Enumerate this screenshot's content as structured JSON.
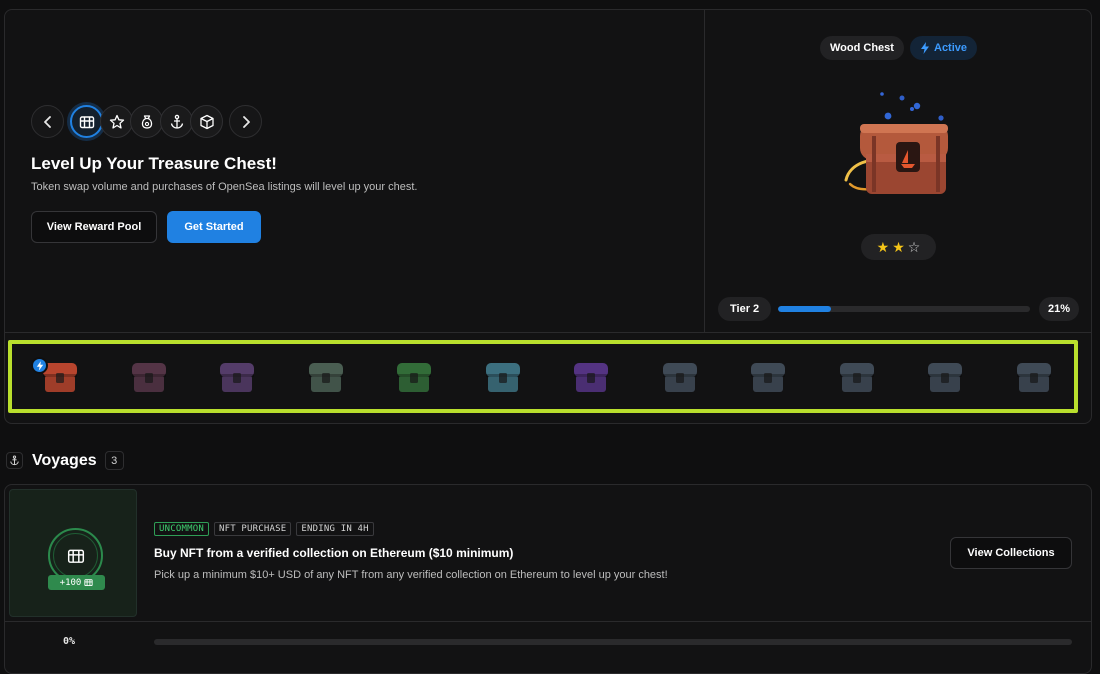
{
  "hero": {
    "title": "Level Up Your Treasure Chest!",
    "subtitle": "Token swap volume and purchases of OpenSea listings will level up your chest.",
    "secondary_button": "View Reward Pool",
    "primary_button": "Get Started",
    "categories": [
      "chest-icon",
      "star-icon",
      "money-bag-icon",
      "anchor-icon",
      "cube-icon"
    ],
    "active_category": 0
  },
  "chest": {
    "name": "Wood Chest",
    "status": "Active",
    "rating": 2,
    "rating_max": 3,
    "tier": "Tier 2",
    "progress_label": "21%",
    "progress": 0.21
  },
  "chest_strip": {
    "items": [
      {
        "color": "#b8452e"
      },
      {
        "color": "#6a4058"
      },
      {
        "color": "#6a4a86"
      },
      {
        "color": "#5d7868"
      },
      {
        "color": "#3d8a45"
      },
      {
        "color": "#4b8fa4"
      },
      {
        "color": "#6a3ea8"
      },
      {
        "color": "#4e5d6d"
      },
      {
        "color": "#4e5d6d"
      },
      {
        "color": "#4e5d6d"
      },
      {
        "color": "#4e5d6d"
      },
      {
        "color": "#4e5d6d"
      }
    ]
  },
  "voyages": {
    "title": "Voyages",
    "count": "3",
    "card": {
      "tags": [
        "UNCOMMON",
        "NFT PURCHASE",
        "ENDING IN 4H"
      ],
      "xp": "+100",
      "title": "Buy NFT from a verified collection on Ethereum ($10 minimum)",
      "description": "Pick up a minimum $10+ USD of any NFT from any verified collection on Ethereum to level up your chest!",
      "button": "View Collections",
      "progress_label": "0%",
      "progress": 0
    }
  },
  "colors": {
    "accent": "#2081e2",
    "highlight": "#b9df2d",
    "success": "#2f9e56",
    "star": "#f5c518"
  }
}
